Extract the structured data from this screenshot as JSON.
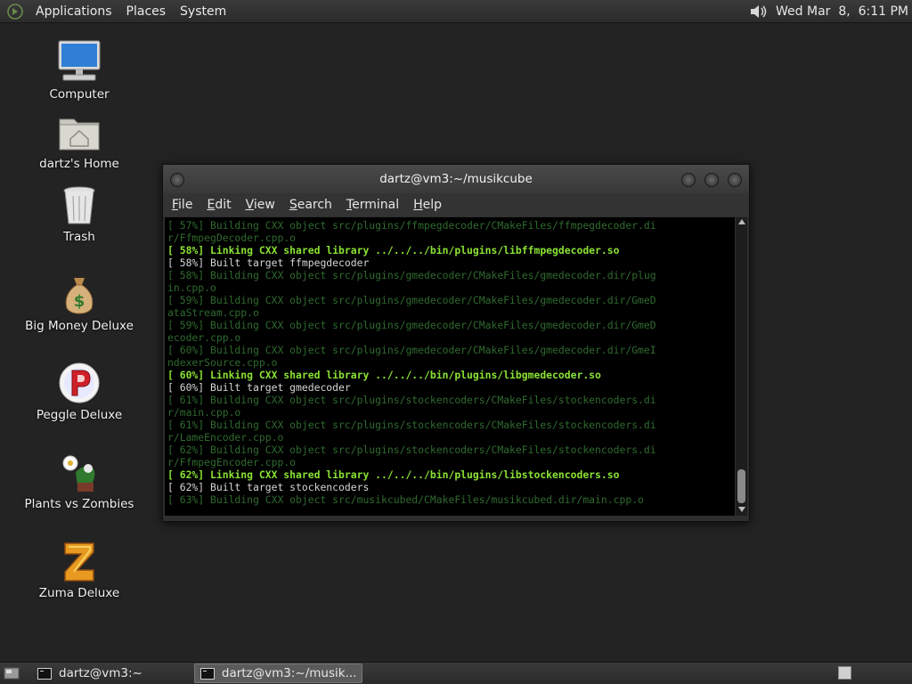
{
  "top_panel": {
    "menus": [
      "Applications",
      "Places",
      "System"
    ],
    "clock": "Wed Mar  8,  6:11 PM"
  },
  "desktop_icons": [
    {
      "label": "Computer",
      "icon": "computer-icon"
    },
    {
      "label": "dartz's Home",
      "icon": "home-folder-icon"
    },
    {
      "label": "Trash",
      "icon": "trash-icon"
    },
    {
      "label": "Big Money Deluxe",
      "icon": "money-bag-icon"
    },
    {
      "label": "Peggle Deluxe",
      "icon": "peggle-icon"
    },
    {
      "label": "Plants vs Zombies",
      "icon": "plants-vs-zombies-icon"
    },
    {
      "label": "Zuma Deluxe",
      "icon": "zuma-icon"
    }
  ],
  "window": {
    "title": "dartz@vm3:~/musikcube",
    "menus": [
      "File",
      "Edit",
      "View",
      "Search",
      "Terminal",
      "Help"
    ],
    "lines": [
      {
        "t": "[ 57%] Building CXX object src/plugins/ffmpegdecoder/CMakeFiles/ffmpegdecoder.di",
        "s": "dim"
      },
      {
        "t": "r/FfmpegDecoder.cpp.o",
        "s": "dim"
      },
      {
        "t": "[ 58%] Linking CXX shared library ../../../bin/plugins/libffmpegdecoder.so",
        "s": "bold"
      },
      {
        "t": "[ 58%] Built target ffmpegdecoder",
        "s": "normal"
      },
      {
        "t": "[ 58%] Building CXX object src/plugins/gmedecoder/CMakeFiles/gmedecoder.dir/plug",
        "s": "dim"
      },
      {
        "t": "in.cpp.o",
        "s": "dim"
      },
      {
        "t": "[ 59%] Building CXX object src/plugins/gmedecoder/CMakeFiles/gmedecoder.dir/GmeD",
        "s": "dim"
      },
      {
        "t": "ataStream.cpp.o",
        "s": "dim"
      },
      {
        "t": "[ 59%] Building CXX object src/plugins/gmedecoder/CMakeFiles/gmedecoder.dir/GmeD",
        "s": "dim"
      },
      {
        "t": "ecoder.cpp.o",
        "s": "dim"
      },
      {
        "t": "[ 60%] Building CXX object src/plugins/gmedecoder/CMakeFiles/gmedecoder.dir/GmeI",
        "s": "dim"
      },
      {
        "t": "ndexerSource.cpp.o",
        "s": "dim"
      },
      {
        "t": "[ 60%] Linking CXX shared library ../../../bin/plugins/libgmedecoder.so",
        "s": "bold"
      },
      {
        "t": "[ 60%] Built target gmedecoder",
        "s": "normal"
      },
      {
        "t": "[ 61%] Building CXX object src/plugins/stockencoders/CMakeFiles/stockencoders.di",
        "s": "dim"
      },
      {
        "t": "r/main.cpp.o",
        "s": "dim"
      },
      {
        "t": "[ 61%] Building CXX object src/plugins/stockencoders/CMakeFiles/stockencoders.di",
        "s": "dim"
      },
      {
        "t": "r/LameEncoder.cpp.o",
        "s": "dim"
      },
      {
        "t": "[ 62%] Building CXX object src/plugins/stockencoders/CMakeFiles/stockencoders.di",
        "s": "dim"
      },
      {
        "t": "r/FfmpegEncoder.cpp.o",
        "s": "dim"
      },
      {
        "t": "[ 62%] Linking CXX shared library ../../../bin/plugins/libstockencoders.so",
        "s": "bold"
      },
      {
        "t": "[ 62%] Built target stockencoders",
        "s": "normal"
      },
      {
        "t": "[ 63%] Building CXX object src/musikcubed/CMakeFiles/musikcubed.dir/main.cpp.o",
        "s": "dim"
      }
    ]
  },
  "taskbar": {
    "tasks": [
      {
        "label": "dartz@vm3:~",
        "active": false
      },
      {
        "label": "dartz@vm3:~/musik...",
        "active": true
      }
    ]
  }
}
